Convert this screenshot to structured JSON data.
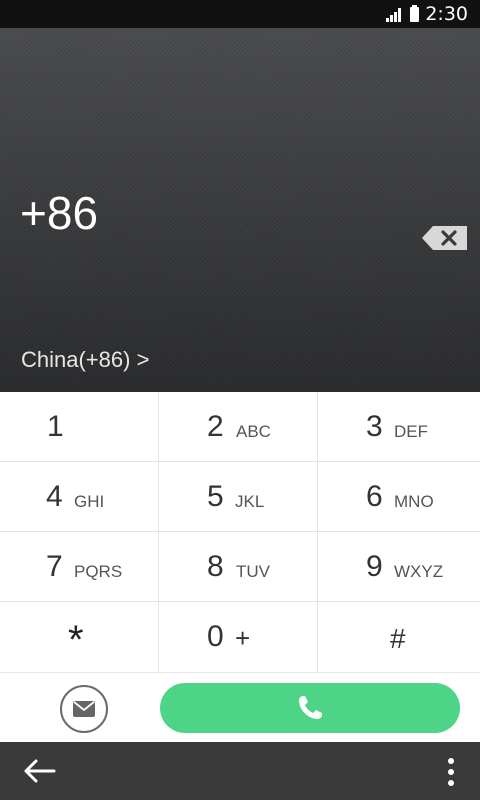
{
  "status_bar": {
    "time": "2:30",
    "icons": [
      "signal-icon",
      "battery-icon"
    ]
  },
  "display": {
    "number": "+86",
    "country": "China(+86) >",
    "icons": [
      "backspace-icon"
    ]
  },
  "keypad": {
    "keys": [
      {
        "digit": "1",
        "letters": ""
      },
      {
        "digit": "2",
        "letters": "ABC"
      },
      {
        "digit": "3",
        "letters": "DEF"
      },
      {
        "digit": "4",
        "letters": "GHI"
      },
      {
        "digit": "5",
        "letters": "JKL"
      },
      {
        "digit": "6",
        "letters": "MNO"
      },
      {
        "digit": "7",
        "letters": "PQRS"
      },
      {
        "digit": "8",
        "letters": "TUV"
      },
      {
        "digit": "9",
        "letters": "WXYZ"
      },
      {
        "digit": "*",
        "letters": ""
      },
      {
        "digit": "0",
        "letters": "+"
      },
      {
        "digit": "#",
        "letters": ""
      }
    ]
  },
  "actions": {
    "icons": [
      "message-icon",
      "phone-icon"
    ],
    "call_color": "#4dd486"
  },
  "nav_bar": {
    "icons": [
      "back-arrow-icon",
      "more-vertical-icon"
    ]
  }
}
